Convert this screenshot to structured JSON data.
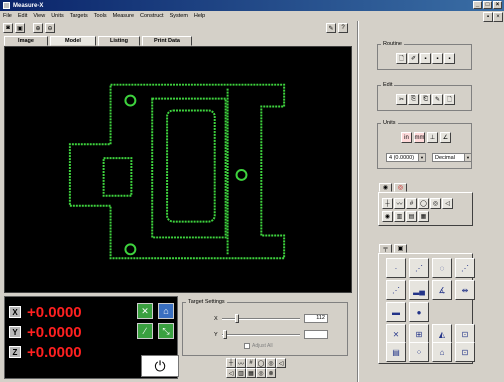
{
  "window": {
    "title": "Measure-X"
  },
  "menu": [
    "File",
    "Edit",
    "View",
    "Units",
    "Targets",
    "Tools",
    "Measure",
    "Construct",
    "System",
    "Help"
  ],
  "tabs": [
    {
      "label": "Image"
    },
    {
      "label": "Model"
    },
    {
      "label": "Listing"
    },
    {
      "label": "Print Data"
    }
  ],
  "readout": {
    "x_axis": "X",
    "x_value": "+0.0000",
    "y_axis": "Y",
    "y_value": "+0.0000",
    "z_axis": "Z",
    "z_value": "+0.0000"
  },
  "target_settings": {
    "title": "Target Settings",
    "x_label": "X",
    "x_value": "112",
    "x_level": 0.18,
    "y_label": "Y",
    "y_value": "",
    "y_level": 0.02,
    "checkbox_label": "Adjust All"
  },
  "routine": {
    "title": "Routine"
  },
  "edit": {
    "title": "Edit"
  },
  "units": {
    "title": "Units",
    "precision": "4 (0.0000)",
    "format": "Decimal"
  },
  "colors": {
    "outline": "#3ed33e",
    "readout_value": "#ff2020",
    "title_start": "#0a246a"
  }
}
